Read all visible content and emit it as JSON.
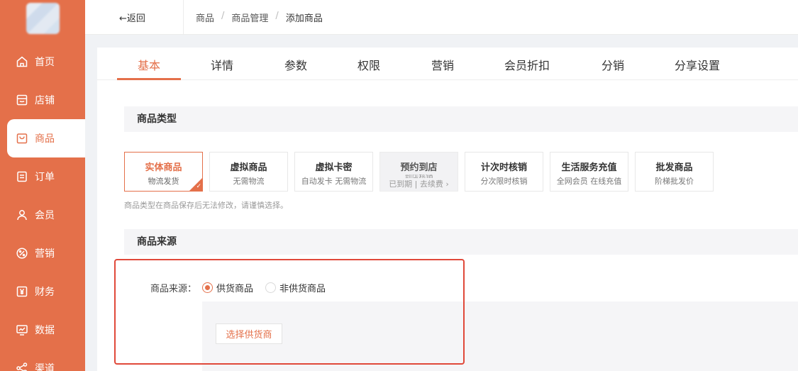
{
  "sidebar": {
    "items": [
      {
        "label": "首页",
        "icon": "home-icon"
      },
      {
        "label": "店铺",
        "icon": "store-icon"
      },
      {
        "label": "商品",
        "icon": "bag-icon",
        "active": true
      },
      {
        "label": "订单",
        "icon": "order-icon"
      },
      {
        "label": "会员",
        "icon": "user-icon"
      },
      {
        "label": "营销",
        "icon": "percent-icon"
      },
      {
        "label": "财务",
        "icon": "yen-icon"
      },
      {
        "label": "数据",
        "icon": "monitor-icon"
      },
      {
        "label": "渠道",
        "icon": "share-icon"
      }
    ]
  },
  "topbar": {
    "back_label": "返回",
    "breadcrumb": [
      "商品",
      "商品管理",
      "添加商品"
    ]
  },
  "tabs": [
    "基本",
    "详情",
    "参数",
    "权限",
    "营销",
    "会员折扣",
    "分销",
    "分享设置"
  ],
  "section_type": {
    "title": "商品类型",
    "cards": [
      {
        "title": "实体商品",
        "desc": "物流发货",
        "selected": true
      },
      {
        "title": "虚拟商品",
        "desc": "无需物流"
      },
      {
        "title": "虚拟卡密",
        "desc": "自动发卡 无需物流"
      },
      {
        "title": "预约到店",
        "desc": "到店核销",
        "extra": "已到期 | 去续费",
        "disabled": true
      },
      {
        "title": "计次时核销",
        "desc": "分次限时核销"
      },
      {
        "title": "生活服务充值",
        "desc": "全网会员 在线充值"
      },
      {
        "title": "批发商品",
        "desc": "阶梯批发价"
      }
    ],
    "hint": "商品类型在商品保存后无法修改，请谨慎选择。"
  },
  "section_source": {
    "title": "商品来源",
    "field_label": "商品来源：",
    "options": [
      {
        "label": "供货商品",
        "checked": true
      },
      {
        "label": "非供货商品",
        "checked": false
      }
    ],
    "select_supplier_label": "选择供货商"
  },
  "colors": {
    "accent": "#e4704a",
    "highlight": "#e0493a"
  }
}
